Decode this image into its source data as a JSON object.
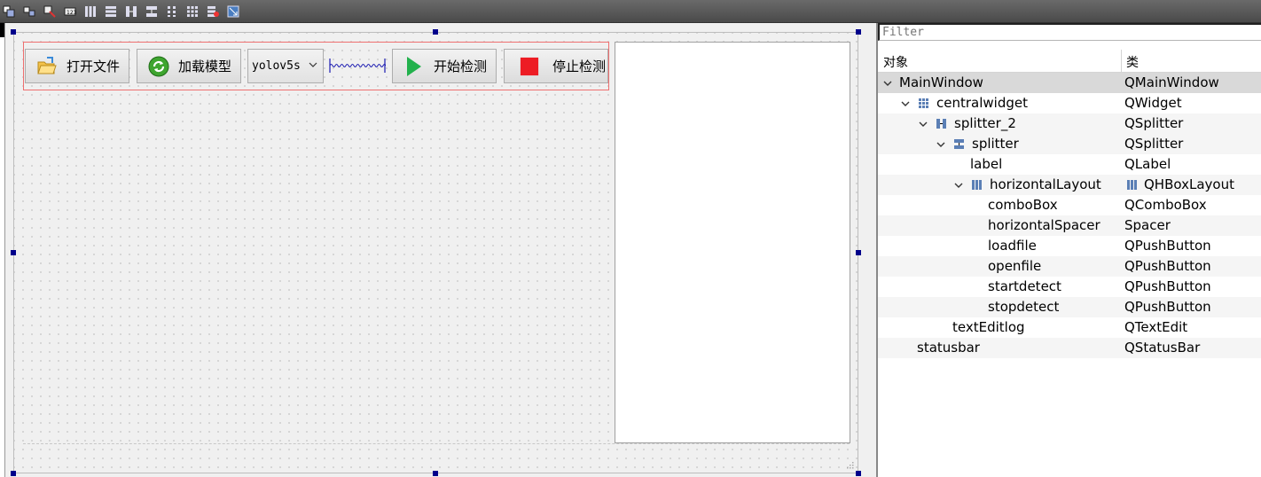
{
  "toolbar": {
    "tools": [
      "edit-widgets-icon",
      "edit-signals-icon",
      "edit-buddies-icon",
      "edit-tab-order-icon",
      "layout-horizontal-icon",
      "layout-vertical-icon",
      "layout-horizontal-splitter-icon",
      "layout-vertical-splitter-icon",
      "layout-form-icon",
      "layout-grid-icon",
      "break-layout-icon",
      "adjust-size-icon"
    ]
  },
  "form": {
    "buttons": {
      "openfile": "打开文件",
      "loadfile": "加载模型",
      "startdetect": "开始检测",
      "stopdetect": "停止检测"
    },
    "combo": {
      "value": "yolov5s"
    }
  },
  "inspector": {
    "filter_placeholder": "Filter",
    "header": {
      "object": "对象",
      "class": "类"
    },
    "rows": [
      {
        "name": "MainWindow",
        "class": "QMainWindow"
      },
      {
        "name": "centralwidget",
        "class": "QWidget"
      },
      {
        "name": "splitter_2",
        "class": "QSplitter"
      },
      {
        "name": "splitter",
        "class": "QSplitter"
      },
      {
        "name": "label",
        "class": "QLabel"
      },
      {
        "name": "horizontalLayout",
        "class": "QHBoxLayout"
      },
      {
        "name": "comboBox",
        "class": "QComboBox"
      },
      {
        "name": "horizontalSpacer",
        "class": "Spacer"
      },
      {
        "name": "loadfile",
        "class": "QPushButton"
      },
      {
        "name": "openfile",
        "class": "QPushButton"
      },
      {
        "name": "startdetect",
        "class": "QPushButton"
      },
      {
        "name": "stopdetect",
        "class": "QPushButton"
      },
      {
        "name": "textEditlog",
        "class": "QTextEdit"
      },
      {
        "name": "statusbar",
        "class": "QStatusBar"
      }
    ]
  },
  "colors": {
    "selection_handle": "#00008b",
    "layout_outline": "#ee6f6f",
    "start_icon": "#22b14c",
    "stop_icon": "#ed1c24"
  }
}
